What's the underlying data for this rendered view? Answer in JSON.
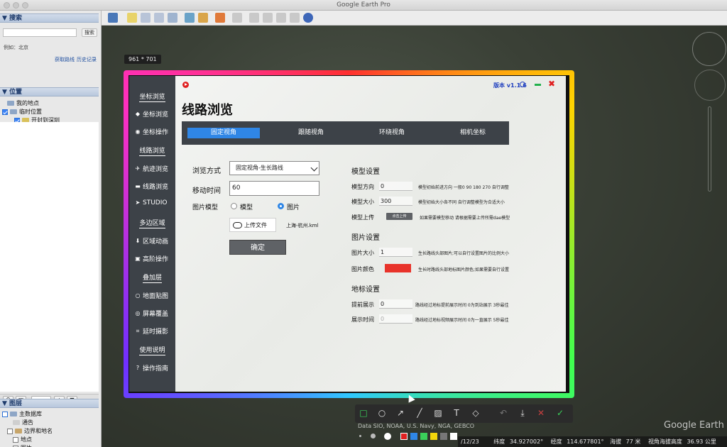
{
  "window": {
    "title": "Google Earth Pro"
  },
  "left_panel": {
    "search": {
      "header": "▼ 搜索",
      "button": "搜索",
      "example": "例如：北京",
      "link_directions": "获取路线",
      "link_history": "历史记录"
    },
    "places": {
      "header": "▼ 位置",
      "my_places": "我的地点",
      "temp_places": "临时位置",
      "route_item": "开封到深圳"
    },
    "layers": {
      "header": "▼ 图层",
      "primary_db": "主数据库",
      "item1": "通告",
      "item2": "边界和地名",
      "item3": "地点",
      "item4": "图片"
    }
  },
  "map": {
    "dimension_label": "961 * 701",
    "attribution": "Data SIO, NOAA, U.S. Navy, NGA, GEBCO",
    "brand": "Google Earth"
  },
  "status": {
    "date": "/12/23",
    "lat_label": "纬度",
    "lat": "34.927002°",
    "lon_label": "经度",
    "lon": "114.677801°",
    "alt_label": "海拔",
    "alt": "77 米",
    "eye_label": "视角海拔高度",
    "eye": "36.93 公里"
  },
  "plugin": {
    "version": "版本 v1.1.6",
    "title": "线路浏览",
    "sidebar": {
      "group1": "坐标浏览",
      "item_coord_browse": "坐标浏览",
      "item_coord_op": "坐标操作",
      "group2": "线路浏览",
      "item_track": "航迹浏览",
      "item_route": "线路浏览",
      "item_studio": "STUDIO",
      "group3": "多边区域",
      "item_area_anim": "区域动画",
      "item_adv": "高阶操作",
      "group4": "叠加层",
      "item_ground": "地面贴图",
      "item_screen": "屏幕覆盖",
      "item_timelapse": "延时摄影",
      "group5": "使用说明",
      "item_guide": "操作指南"
    },
    "tabs": [
      "固定视角",
      "跟随视角",
      "环绕视角",
      "相机坐标"
    ],
    "form": {
      "browse_mode_label": "浏览方式",
      "browse_mode_value": "固定视角-生长路线",
      "move_time_label": "移动时间",
      "move_time_value": "60",
      "image_model_label": "图片模型",
      "radio_model": "模型",
      "radio_image": "图片",
      "upload_label": "上传文件",
      "upload_file": "上海-杭州.kml",
      "confirm": "确定"
    },
    "model_settings": {
      "title": "模型设置",
      "direction_label": "模型方向",
      "direction_value": "0",
      "direction_desc": "模型初始前进方向 一般0 90 180 270 自行调整",
      "size_label": "模型大小",
      "size_value": "300",
      "size_desc": "模型初始大小各不同 自行调整模型为合适大小",
      "upload_label": "模型上传",
      "upload_btn": "点击上传",
      "upload_desc": "如果需要模型移动 请根据需要上传所需dae模型"
    },
    "image_settings": {
      "title": "图片设置",
      "size_label": "图片大小",
      "size_value": "1",
      "size_desc": "生长路线头部图片;可以自行设置图片的比例大小",
      "color_label": "图片颜色",
      "color_value": "#e8332a",
      "color_desc": "生长时路线头部地标图片颜色;如果需要自行设置"
    },
    "landmark_settings": {
      "title": "地标设置",
      "advance_label": "提前展示",
      "advance_value": "0",
      "advance_desc": "路线经过地标提前展示时间 0为到站展示 3秒最佳",
      "show_label": "展示时间",
      "show_value": "0",
      "show_desc": "路线经过地标视频展示时间 0为一直展示 5秒最佳"
    }
  },
  "colors": {
    "accent": "#2f86e6",
    "sidebar": "#3d4248",
    "close": "#e02020",
    "minimize": "#22b14c"
  }
}
